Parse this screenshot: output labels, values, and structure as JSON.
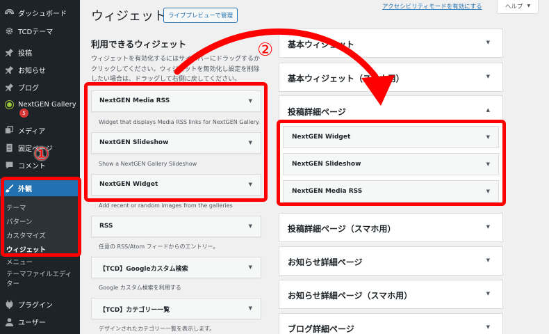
{
  "sidebar": {
    "items": [
      {
        "label": "ダッシュボード",
        "icon": "dashboard-icon"
      },
      {
        "label": "TCDテーマ",
        "icon": "gear-icon"
      },
      {
        "label": "投稿",
        "icon": "pin-icon"
      },
      {
        "label": "お知らせ",
        "icon": "pin-icon"
      },
      {
        "label": "ブログ",
        "icon": "pin-icon"
      },
      {
        "label": "NextGEN Gallery",
        "icon": "nextgen-icon",
        "badge": "5"
      },
      {
        "label": "メディア",
        "icon": "media-icon"
      },
      {
        "label": "固定ページ",
        "icon": "page-icon"
      },
      {
        "label": "コメント",
        "icon": "comment-icon"
      },
      {
        "label": "外観",
        "icon": "brush-icon"
      },
      {
        "label": "プラグイン",
        "icon": "plugin-icon"
      },
      {
        "label": "ユーザー",
        "icon": "user-icon"
      }
    ],
    "appearance_submenu": [
      "テーマ",
      "パターン",
      "カスタマイズ",
      "ウィジェット"
    ],
    "extra_items": [
      "メニュー",
      "テーマファイルエディター"
    ]
  },
  "header": {
    "title": "ウィジェット",
    "live_preview_button": "ライブプレビューで管理",
    "accessibility_link": "アクセシビリティモードを有効にする",
    "help_tab": "ヘルプ"
  },
  "available": {
    "heading": "利用できるウィジェット",
    "description": "ウィジェットを有効化するにはサイドバーにドラッグするかクリックしてください。ウィジェットを無効化し設定を削除したい場合は、ドラッグして右側に戻してください。",
    "widgets": [
      {
        "title": "NextGEN Media RSS",
        "desc": "Widget that displays Media RSS links for NextGEN Gallery."
      },
      {
        "title": "NextGEN Slideshow",
        "desc": "Show a NextGEN Gallery Slideshow"
      },
      {
        "title": "NextGEN Widget",
        "desc": "Add recent or random images from the galleries"
      },
      {
        "title": "RSS",
        "desc": "任意の RSS/Atom フィードからのエントリー。"
      },
      {
        "title": "【TCD】Googleカスタム検索",
        "desc": "Google カスタム検索を利用する"
      },
      {
        "title": "【TCD】カテゴリー一覧",
        "desc": "デザインされたカテゴリー一覧を表示します。"
      }
    ]
  },
  "sidebars": {
    "areas": [
      {
        "title": "基本ウィジェット"
      },
      {
        "title": "基本ウィジェット（スマホ用）"
      },
      {
        "title": "投稿詳細ページ",
        "widgets": [
          "NextGEN Widget",
          "NextGEN Slideshow",
          "NextGEN Media RSS"
        ]
      },
      {
        "title": "投稿詳細ページ（スマホ用）"
      },
      {
        "title": "お知らせ詳細ページ"
      },
      {
        "title": "お知らせ詳細ページ（スマホ用）"
      },
      {
        "title": "ブログ詳細ページ"
      }
    ]
  },
  "annotations": {
    "step1": "①",
    "step2": "②",
    "color": "#ff0000"
  },
  "colors": {
    "admin_bar": "#1d2327",
    "accent": "#2271b1"
  }
}
